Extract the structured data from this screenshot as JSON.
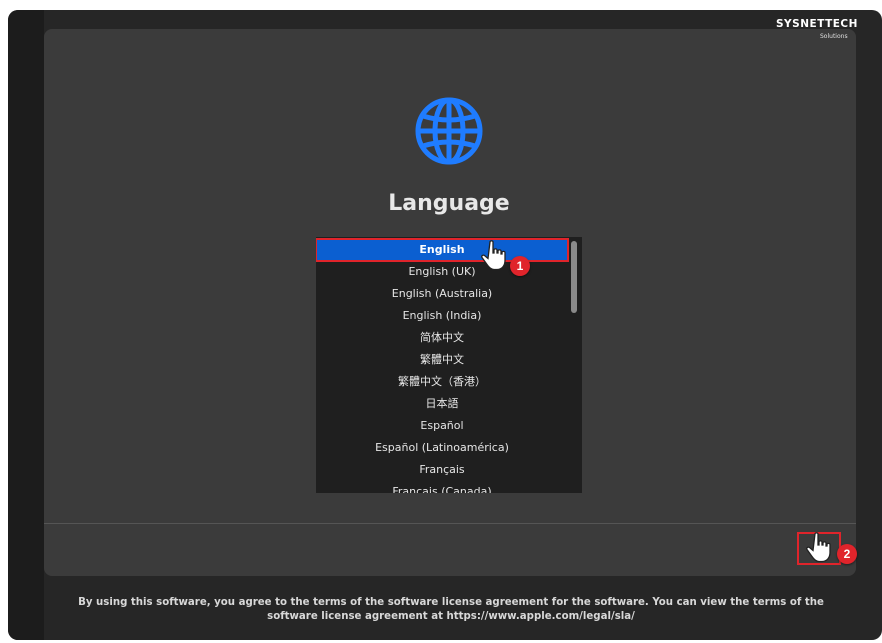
{
  "brand": {
    "name": "SYSNETTECH",
    "subtitle": "Solutions"
  },
  "installer": {
    "title": "Language",
    "globe_color": "#1f7cff",
    "languages": [
      {
        "label": "English",
        "selected": true
      },
      {
        "label": "English (UK)",
        "selected": false
      },
      {
        "label": "English (Australia)",
        "selected": false
      },
      {
        "label": "English (India)",
        "selected": false
      },
      {
        "label": "简体中文",
        "selected": false
      },
      {
        "label": "繁體中文",
        "selected": false
      },
      {
        "label": "繁體中文（香港）",
        "selected": false
      },
      {
        "label": "日本語",
        "selected": false
      },
      {
        "label": "Español",
        "selected": false
      },
      {
        "label": "Español (Latinoamérica)",
        "selected": false
      },
      {
        "label": "Français",
        "selected": false
      },
      {
        "label": "Français (Canada)",
        "selected": false
      }
    ]
  },
  "annotations": {
    "step1": "1",
    "step2": "2",
    "highlight_color": "#e0242b"
  },
  "footer": {
    "license_text": "By using this software, you agree to the terms of the software license agreement for the software. You can view the terms of the software license agreement at https://www.apple.com/legal/sla/"
  }
}
